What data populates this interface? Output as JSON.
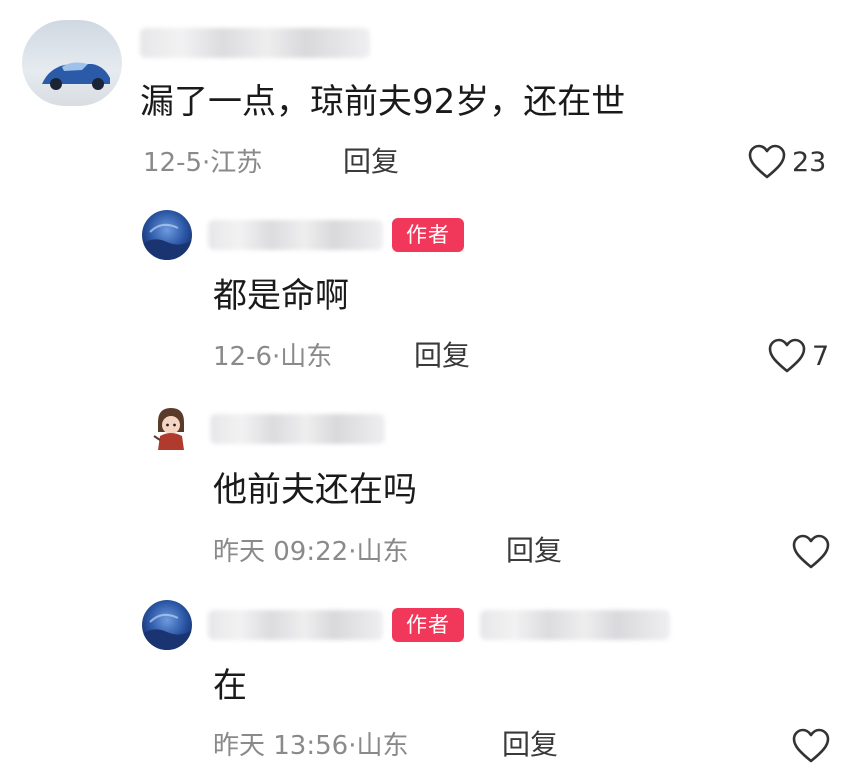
{
  "colors": {
    "author_badge": "#f2385a",
    "meta_text": "#8a8a8a",
    "body_text": "#1a1a1a"
  },
  "comments": [
    {
      "text": "漏了一点，琼前夫92岁，还在世",
      "date": "12-5",
      "location": "江苏",
      "reply_label": "回复",
      "likes": "23",
      "avatar": "car-avatar"
    },
    {
      "badge": "作者",
      "text": "都是命啊",
      "date": "12-6",
      "location": "山东",
      "reply_label": "回复",
      "likes": "7",
      "avatar": "blue-night-avatar"
    },
    {
      "text": "他前夫还在吗",
      "date": "昨天 09:22",
      "location": "山东",
      "reply_label": "回复",
      "avatar": "cartoon-girl-avatar"
    },
    {
      "badge": "作者",
      "text": "在",
      "date": "昨天 13:56",
      "location": "山东",
      "reply_label": "回复",
      "avatar": "blue-night-avatar"
    }
  ],
  "separator": "·"
}
